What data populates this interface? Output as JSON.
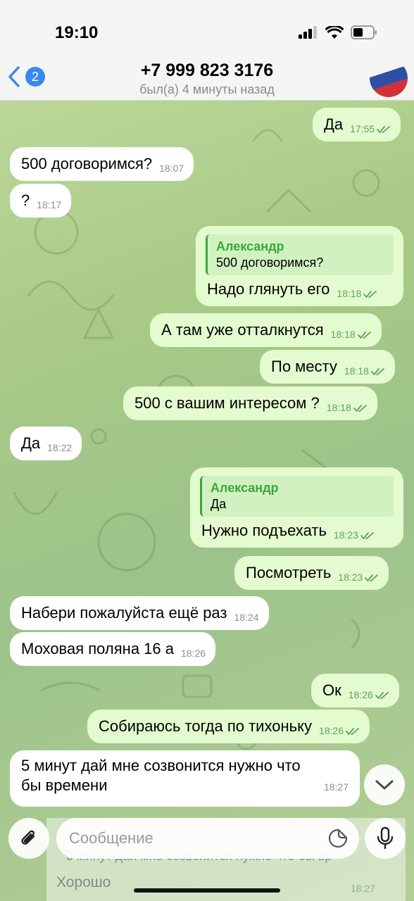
{
  "status_bar": {
    "time": "19:10"
  },
  "header": {
    "back_count": "2",
    "title": "+7 999 823 3176",
    "subtitle": "был(а) 4 минуты назад"
  },
  "messages": [
    {
      "dir": "out",
      "text": "Да",
      "time": "17:55"
    },
    {
      "dir": "in",
      "text": "500 договоримся?",
      "time": "18:07"
    },
    {
      "dir": "in",
      "text": "?",
      "time": "18:17"
    },
    {
      "dir": "out",
      "reply_name": "Александр",
      "reply_text": "500 договоримся?",
      "text": "Надо глянуть его",
      "time": "18:18"
    },
    {
      "dir": "out",
      "text": "А там уже отталкнутся",
      "time": "18:18"
    },
    {
      "dir": "out",
      "text": "По месту",
      "time": "18:18"
    },
    {
      "dir": "out",
      "text": "500 с вашим интересом ?",
      "time": "18:18"
    },
    {
      "dir": "in",
      "text": "Да",
      "time": "18:22"
    },
    {
      "dir": "out",
      "reply_name": "Александр",
      "reply_text": "Да",
      "text": "Нужно подъехать",
      "time": "18:23"
    },
    {
      "dir": "out",
      "text": "Посмотреть",
      "time": "18:23"
    },
    {
      "dir": "in",
      "text": "Набери пожалуйста ещё раз",
      "time": "18:24"
    },
    {
      "dir": "in",
      "text": "Моховая поляна 16 а",
      "time": "18:26"
    },
    {
      "dir": "out",
      "text": "Ок",
      "time": "18:26"
    },
    {
      "dir": "out",
      "text": "Собираюсь тогда по тихоньку",
      "time": "18:26"
    },
    {
      "dir": "in",
      "text_line1": "5 минут дай мне созвонится нужно что",
      "text_line2": "бы времени",
      "time": "18:27"
    }
  ],
  "ghost": {
    "quote_text": "5 минут дай мне созвонится нужно что бы вр",
    "reply_text": "Хорошо",
    "time": "18:27"
  },
  "composer": {
    "placeholder": "Сообщение"
  },
  "icons": {
    "back": "chevron-left-icon",
    "read_receipt": "double-check-icon",
    "scroll": "chevron-down-icon",
    "attach": "paperclip-icon",
    "sticker": "sticker-icon",
    "mic": "microphone-icon"
  },
  "colors": {
    "outgoing_bubble": "#e3fbcf",
    "incoming_bubble": "#ffffff",
    "accent_blue": "#3a86f4",
    "reply_green": "#3aa83c"
  }
}
